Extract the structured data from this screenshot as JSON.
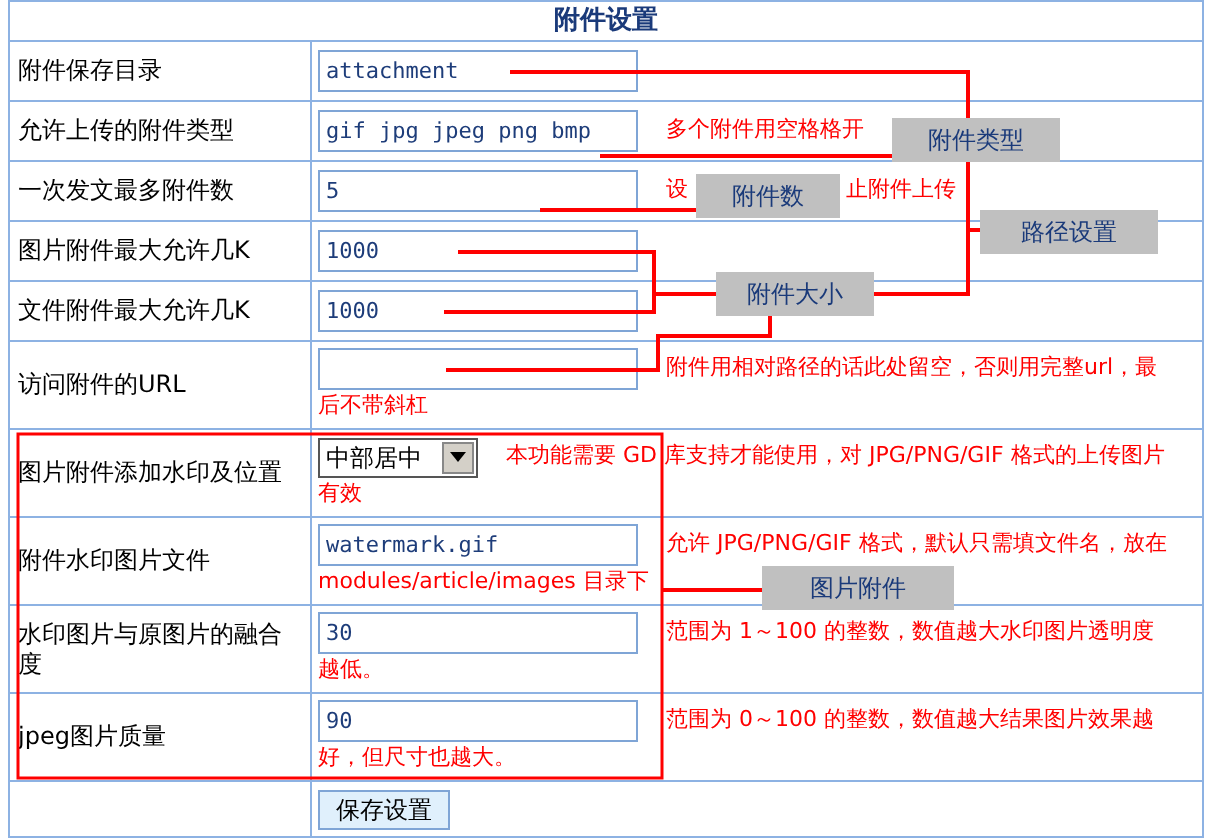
{
  "title": "附件设置",
  "rows": [
    {
      "kind": "text",
      "label": "附件保存目录",
      "value": "attachment",
      "hint": []
    },
    {
      "kind": "text",
      "label": "允许上传的附件类型",
      "value": "gif jpg jpeg png bmp",
      "hint": [
        "多个附件用空格格开"
      ]
    },
    {
      "kind": "text",
      "label": "一次发文最多附件数",
      "value": "5",
      "hint": [
        "设"
      ],
      "hint_tail": "止附件上传"
    },
    {
      "kind": "text",
      "label": "图片附件最大允许几K",
      "value": "1000",
      "hint": []
    },
    {
      "kind": "text",
      "label": "文件附件最大允许几K",
      "value": "1000",
      "hint": []
    },
    {
      "kind": "text",
      "label": "访问附件的URL",
      "value": "",
      "hint": [
        "附件用相对路径的话此处留空，否则用完整url，最",
        "后不带斜杠"
      ]
    },
    {
      "kind": "select",
      "label": "图片附件添加水印及位置",
      "value": "中部居中",
      "hint": [
        "本功能需要 GD 库支持才能使用，对 JPG/PNG/GIF 格式的上传图片",
        "有效"
      ]
    },
    {
      "kind": "text",
      "label": "附件水印图片文件",
      "value": "watermark.gif",
      "hint": [
        "允许 JPG/PNG/GIF 格式，默认只需填文件名，放在",
        "modules/article/images 目录下"
      ]
    },
    {
      "kind": "text",
      "label": "水印图片与原图片的融合度",
      "value": "30",
      "hint": [
        "范围为 1～100 的整数，数值越大水印图片透明度",
        "越低。"
      ]
    },
    {
      "kind": "text",
      "label": "jpeg图片质量",
      "value": "90",
      "hint": [
        "范围为 0～100 的整数，数值越大结果图片效果越",
        "好，但尺寸也越大。"
      ]
    },
    {
      "kind": "button",
      "label": "",
      "value": "保存设置",
      "hint": []
    }
  ],
  "callouts": [
    "附件类型",
    "附件数",
    "路径设置",
    "附件大小",
    "图片附件"
  ]
}
